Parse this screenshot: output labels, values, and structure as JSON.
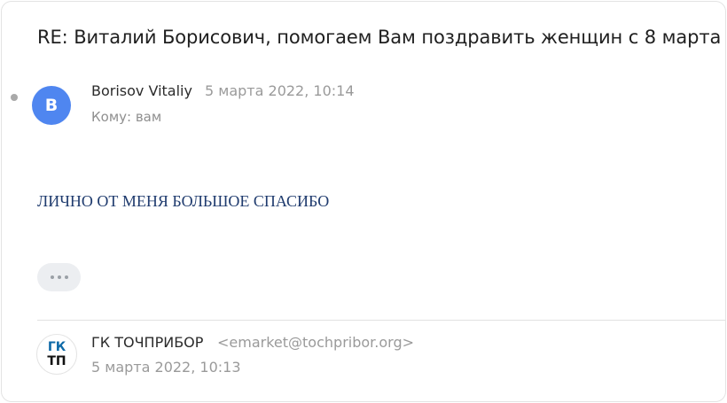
{
  "thread": {
    "subject": "RE: Виталий Борисович, помогаем Вам поздравить женщин с 8 марта"
  },
  "message": {
    "avatar_letter": "B",
    "sender_name": "Borisov Vitaliy",
    "date": "5 марта 2022, 10:14",
    "recipient": "Кому: вам",
    "body": "ЛИЧНО ОТ МЕНЯ БОЛЬШОЕ СПАСИБО"
  },
  "quoted": {
    "logo_line1": "ГК",
    "logo_line2": "ТП",
    "sender_name": "ГК ТОЧПРИБОР",
    "sender_email": "<emarket@tochpribor.org>",
    "date": "5 марта 2022, 10:13"
  },
  "colors": {
    "avatar": "#4f86f0",
    "body_text": "#1f3b6e",
    "logo_accent": "#0f6aa8"
  },
  "icons": {
    "more": "ellipsis-icon",
    "unread": "unread-dot-icon"
  }
}
